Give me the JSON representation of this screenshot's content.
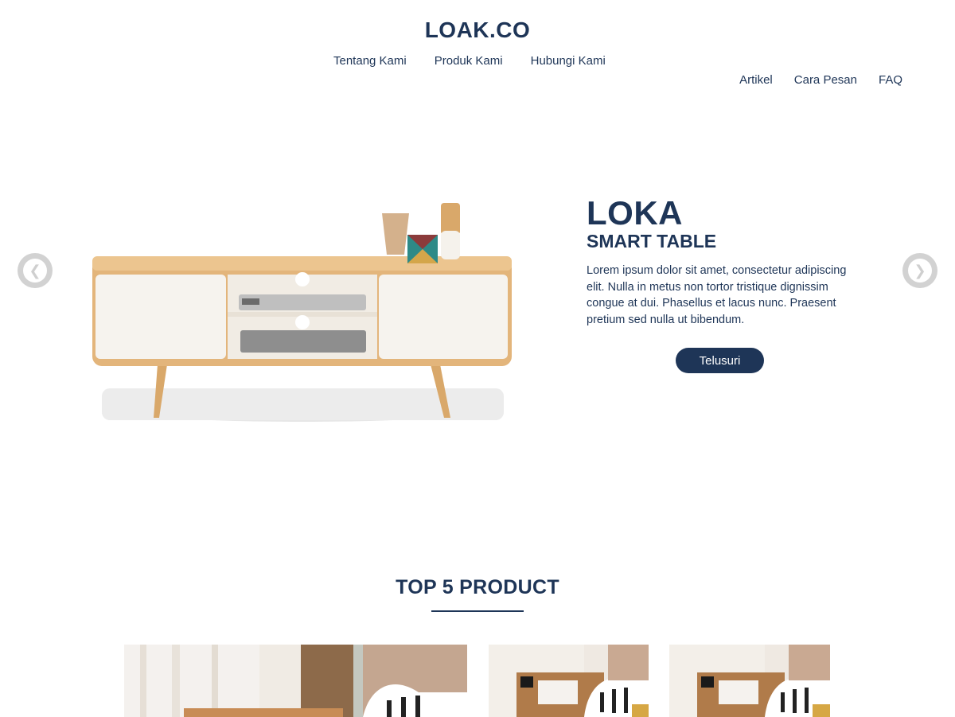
{
  "header": {
    "logo": "LOAK.CO",
    "nav_main": [
      "Tentang Kami",
      "Produk Kami",
      "Hubungi Kami"
    ],
    "nav_secondary": [
      "Artikel",
      "Cara Pesan",
      "FAQ"
    ]
  },
  "hero": {
    "title": "LOKA",
    "subtitle": "SMART TABLE",
    "description": "Lorem ipsum dolor sit amet, consectetur adipiscing elit. Nulla in metus non tortor tristique dignissim congue at dui. Phasellus et lacus nunc. Praesent pretium sed nulla ut bibendum.",
    "cta_label": "Telusuri",
    "prev_icon": "chevron-left-icon",
    "next_icon": "chevron-right-icon"
  },
  "products": {
    "title": "TOP 5 PRODUCT"
  },
  "colors": {
    "primary": "#1e3557",
    "arrow_gray": "#d2d2d2",
    "background": "#ffffff"
  }
}
